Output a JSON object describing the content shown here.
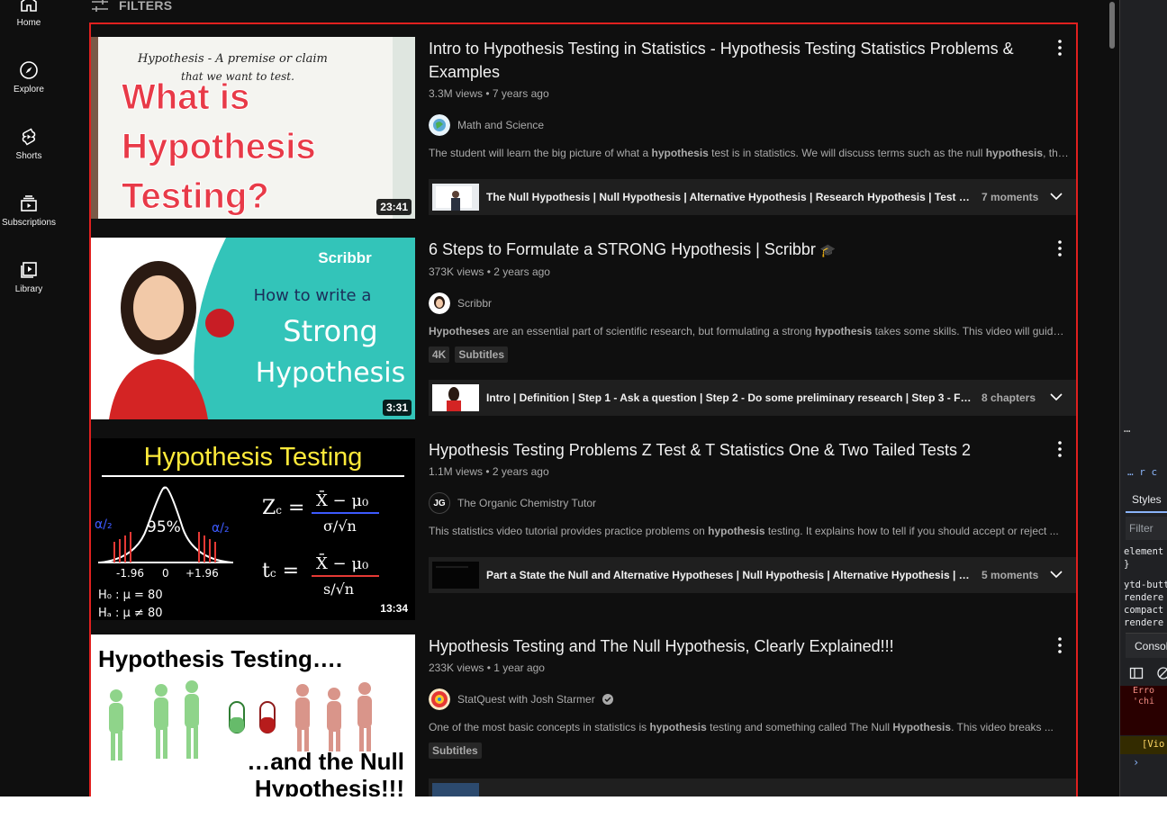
{
  "guide": {
    "items": [
      {
        "label": "Home",
        "icon": "home-icon"
      },
      {
        "label": "Explore",
        "icon": "compass-icon"
      },
      {
        "label": "Shorts",
        "icon": "shorts-icon"
      },
      {
        "label": "Subscriptions",
        "icon": "subscriptions-icon"
      },
      {
        "label": "Library",
        "icon": "library-icon"
      }
    ]
  },
  "filters": {
    "label": "FILTERS",
    "icon": "filters-icon"
  },
  "highlight_color": "#e0201f",
  "videos": [
    {
      "title": "Intro to Hypothesis Testing in Statistics - Hypothesis Testing Statistics Problems & Examples",
      "views": "3.3M views",
      "age": "7 years ago",
      "meta_sep": "•",
      "channel": "Math and Science",
      "verified": false,
      "description_parts": [
        "The student will learn the big picture of what a ",
        "hypothesis",
        " test is in statistics. We will discuss terms such as the null ",
        "hypothesis",
        ", the ..."
      ],
      "duration": "23:41",
      "thumb_text": {
        "handwriting1": "Hypothesis - A premise or claim",
        "handwriting2": "that we want to test.",
        "line1": "What is",
        "line2": "Hypothesis",
        "line3": "Testing?"
      },
      "moments": {
        "text": "The Null Hypothesis | Null Hypothesis | Alternative Hypothesis | Research Hypothesis | Test Statistic ...",
        "count": "7 moments"
      }
    },
    {
      "title": "6 Steps to Formulate a STRONG Hypothesis | Scribbr",
      "title_emoji": "🎓",
      "views": "373K views",
      "age": "2 years ago",
      "meta_sep": "•",
      "channel": "Scribbr",
      "verified": false,
      "description_parts": [
        "",
        "Hypotheses",
        " are an essential part of scientific research, but formulating a strong ",
        "hypothesis",
        " takes some skills. This video will guide ..."
      ],
      "badges": [
        "4K",
        "Subtitles"
      ],
      "duration": "3:31",
      "thumb_text": {
        "brand": "Scribbr",
        "line1": "How to write a",
        "line2": "Strong",
        "line3": "Hypothesis"
      },
      "moments": {
        "text": "Intro | Definition | Step 1 - Ask a question | Step 2 - Do some preliminary research | Step 3 - Formulate...",
        "count": "8 chapters"
      }
    },
    {
      "title": "Hypothesis Testing Problems Z Test & T Statistics One & Two Tailed Tests 2",
      "views": "1.1M views",
      "age": "2 years ago",
      "meta_sep": "•",
      "channel": "The Organic Chemistry Tutor",
      "channel_initials": "JG",
      "verified": false,
      "description_parts": [
        "This statistics video tutorial provides practice problems on ",
        "hypothesis",
        " testing. It explains how to tell if you should accept or reject ..."
      ],
      "duration": "13:34",
      "thumb_text": {
        "heading": "Hypothesis Testing",
        "pct": "95%",
        "neg": "-1.96",
        "zero": "0",
        "pos": "+1.96",
        "h0": "H₀ : μ = 80",
        "ha": "Hₐ : μ ≠ 80",
        "alpha": "α/₂"
      },
      "moments": {
        "text": "Part a State the Null and Alternative Hypotheses | Null Hypothesis | Alternative Hypothesis | State th...",
        "count": "5 moments"
      }
    },
    {
      "title": "Hypothesis Testing and The Null Hypothesis, Clearly Explained!!!",
      "views": "233K views",
      "age": "1 year ago",
      "meta_sep": "•",
      "channel": "StatQuest with Josh Starmer",
      "verified": true,
      "description_parts": [
        "One of the most basic concepts in statistics is ",
        "hypothesis",
        " testing and something called The Null ",
        "Hypothesis",
        ". This video breaks ..."
      ],
      "badges": [
        "Subtitles"
      ],
      "thumb_text": {
        "line1": "Hypothesis Testing….",
        "line2": "…and the Null",
        "line3": "Hypothesis!!!"
      }
    }
  ],
  "devtools": {
    "dots": "⋯",
    "breadcrumb": "… r c",
    "styles_tab": "Styles",
    "filter_placeholder": "Filter",
    "code1": "element\n}",
    "code2": "ytd-butt\nrendere\ncompact\nrendere",
    "console_tab": "Console",
    "error": "Erro\n'chi",
    "warning": "[Vio",
    "prompt": "›"
  }
}
